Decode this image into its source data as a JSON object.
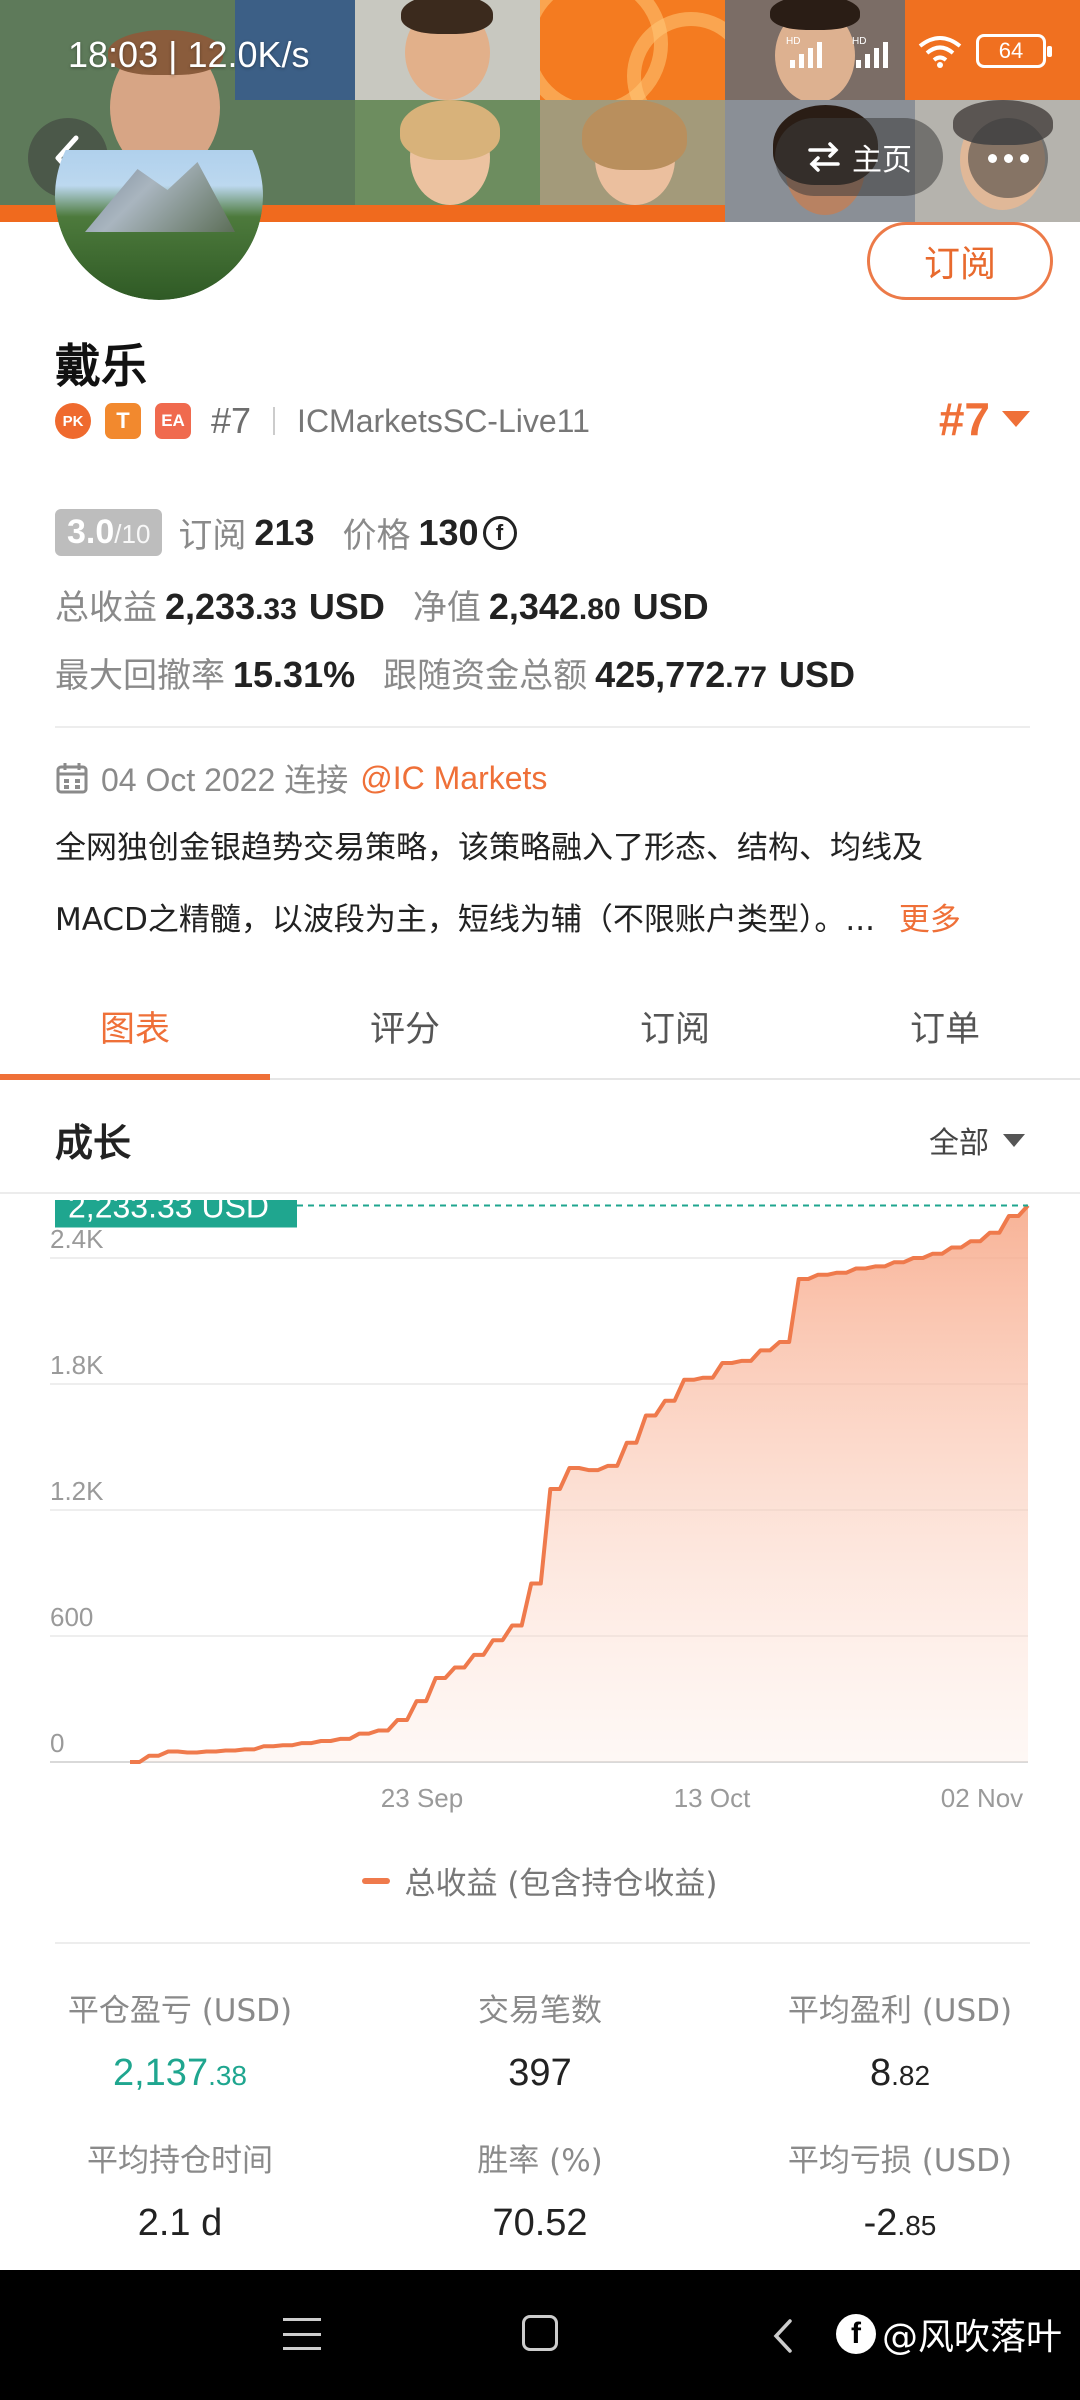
{
  "status_bar": {
    "time": "18:03 | 12.0K/s",
    "battery": "64"
  },
  "header": {
    "home_label": "主页"
  },
  "profile": {
    "name": "戴乐",
    "subscribe_label": "订阅",
    "badges": {
      "pk": "PK",
      "t": "T",
      "ea": "EA"
    },
    "rank": "#7",
    "account": "ICMarketsSC-Live11",
    "rank_big": "#7"
  },
  "stats": {
    "score": "3.0",
    "score_max": "/10",
    "subscribe_label": "订阅",
    "subscribe_count": "213",
    "price_label": "价格",
    "price_value": "130",
    "price_icon": "f",
    "total_profit_label": "总收益",
    "total_profit_int": "2,233",
    "total_profit_dec": ".33",
    "total_profit_unit": "USD",
    "equity_label": "净值",
    "equity_int": "2,342",
    "equity_dec": ".80",
    "equity_unit": "USD",
    "drawdown_label": "最大回撤率",
    "drawdown_value": "15.31%",
    "follow_label": "跟随资金总额",
    "follow_int": "425,772",
    "follow_dec": ".77",
    "follow_unit": "USD"
  },
  "connect": {
    "date_text": "04 Oct 2022 连接",
    "broker": "@IC Markets"
  },
  "description": {
    "line1": "全网独创金银趋势交易策略，该策略融入了形态、结构、均线及",
    "line2": "MACD之精髓，以波段为主，短线为辅（不限账户类型）。...",
    "more": "更多"
  },
  "tabs": [
    "图表",
    "评分",
    "订阅",
    "订单"
  ],
  "section": {
    "title": "成长",
    "filter": "全部"
  },
  "chart_data": {
    "type": "area",
    "title": "成长",
    "y_ticks": [
      "0",
      "600",
      "1.2K",
      "1.8K",
      "2.4K"
    ],
    "x_ticks": [
      "23 Sep",
      "13 Oct",
      "02 Nov"
    ],
    "ylim": [
      0,
      2400
    ],
    "current_label": "2,233.33 USD",
    "current_value": 2233.33,
    "legend": "总收益 (包含持仓收益)",
    "series": [
      {
        "name": "总收益 (包含持仓收益)",
        "color": "#ef7a4c",
        "values": [
          0,
          30,
          50,
          45,
          50,
          55,
          60,
          75,
          80,
          90,
          100,
          110,
          135,
          150,
          200,
          290,
          400,
          450,
          510,
          580,
          650,
          850,
          1300,
          1400,
          1390,
          1410,
          1520,
          1650,
          1720,
          1820,
          1830,
          1900,
          1910,
          1960,
          2000,
          2300,
          2320,
          2330,
          2350,
          2360,
          2380,
          2400,
          2420,
          2450,
          2480,
          2520,
          2600,
          2650
        ]
      }
    ]
  },
  "metrics": [
    {
      "label": "平仓盈亏 (USD)",
      "int": "2,137",
      "dec": ".38",
      "green": true
    },
    {
      "label": "交易笔数",
      "int": "397",
      "dec": "",
      "green": false
    },
    {
      "label": "平均盈利 (USD)",
      "int": "8",
      "dec": ".82",
      "green": false
    },
    {
      "label": "平均持仓时间",
      "int": "2.1 d",
      "dec": "",
      "green": false
    },
    {
      "label": "胜率 (%)",
      "int": "70.52",
      "dec": "",
      "green": false
    },
    {
      "label": "平均亏损 (USD)",
      "int": "-2",
      "dec": ".85",
      "green": false
    }
  ],
  "navbar": {
    "watermark": "@风吹落叶",
    "fb": "f"
  },
  "colors": {
    "accent": "#ef7038",
    "green": "#1fa68f",
    "line": "#ef7a4c"
  }
}
